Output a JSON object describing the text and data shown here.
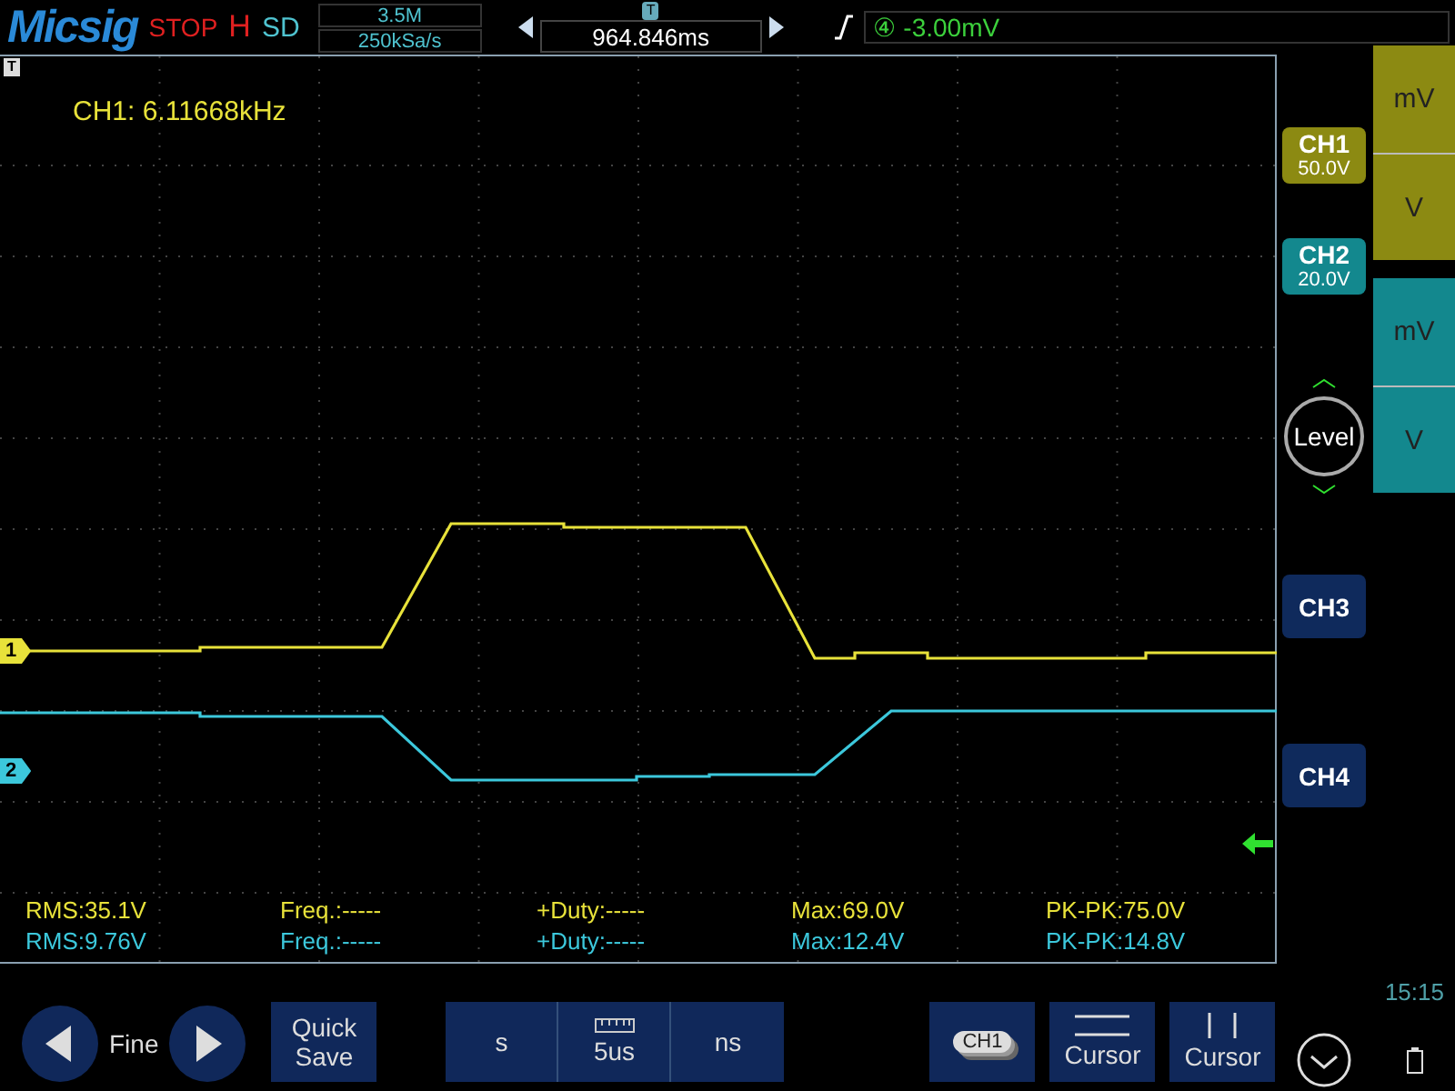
{
  "top_bar": {
    "brand": "Micsig",
    "run_state": "STOP",
    "trigger_mode": "H",
    "acquire_mode": "SD",
    "memory_depth": "3.5M",
    "sample_rate": "250kSa/s",
    "position_marker": "T",
    "timebase_position": "964.846ms",
    "trigger_level": "④ -3.00mV"
  },
  "scope": {
    "trigger_marker": "T",
    "frequency_readout": "CH1: 6.11668kHz",
    "traces": [
      {
        "label": "1",
        "color": "#e8e23a"
      },
      {
        "label": "2",
        "color": "#3cc8dc"
      }
    ],
    "measurements": [
      {
        "color": "#e8e23a",
        "items": [
          "RMS:35.1V",
          "Freq.:-----",
          "+Duty:-----",
          "Max:69.0V",
          "PK-PK:75.0V"
        ]
      },
      {
        "color": "#3cc8dc",
        "items": [
          "RMS:9.76V",
          "Freq.:-----",
          "+Duty:-----",
          "Max:12.4V",
          "PK-PK:14.8V"
        ]
      }
    ]
  },
  "channels": [
    {
      "label": "CH1",
      "scale": "50.0V",
      "color": "#8c8a12"
    },
    {
      "label": "CH2",
      "scale": "20.0V",
      "color": "#13888e"
    },
    {
      "label": "CH3",
      "color": "#0f2a5c"
    },
    {
      "label": "CH4",
      "color": "#0f2a5c"
    }
  ],
  "scale_buttons": [
    {
      "color": "#8c8a12",
      "units": [
        "mV",
        "V"
      ]
    },
    {
      "color": "#13888e",
      "units": [
        "mV",
        "V"
      ]
    }
  ],
  "level_knob": "Level",
  "bottom_bar": {
    "fine": "Fine",
    "quick_save": "Quick Save",
    "timebase": [
      "s",
      "5us",
      "ns"
    ],
    "channel_button": "CH1",
    "cursors": [
      "Cursor",
      "Cursor"
    ],
    "clock": "15:15"
  }
}
